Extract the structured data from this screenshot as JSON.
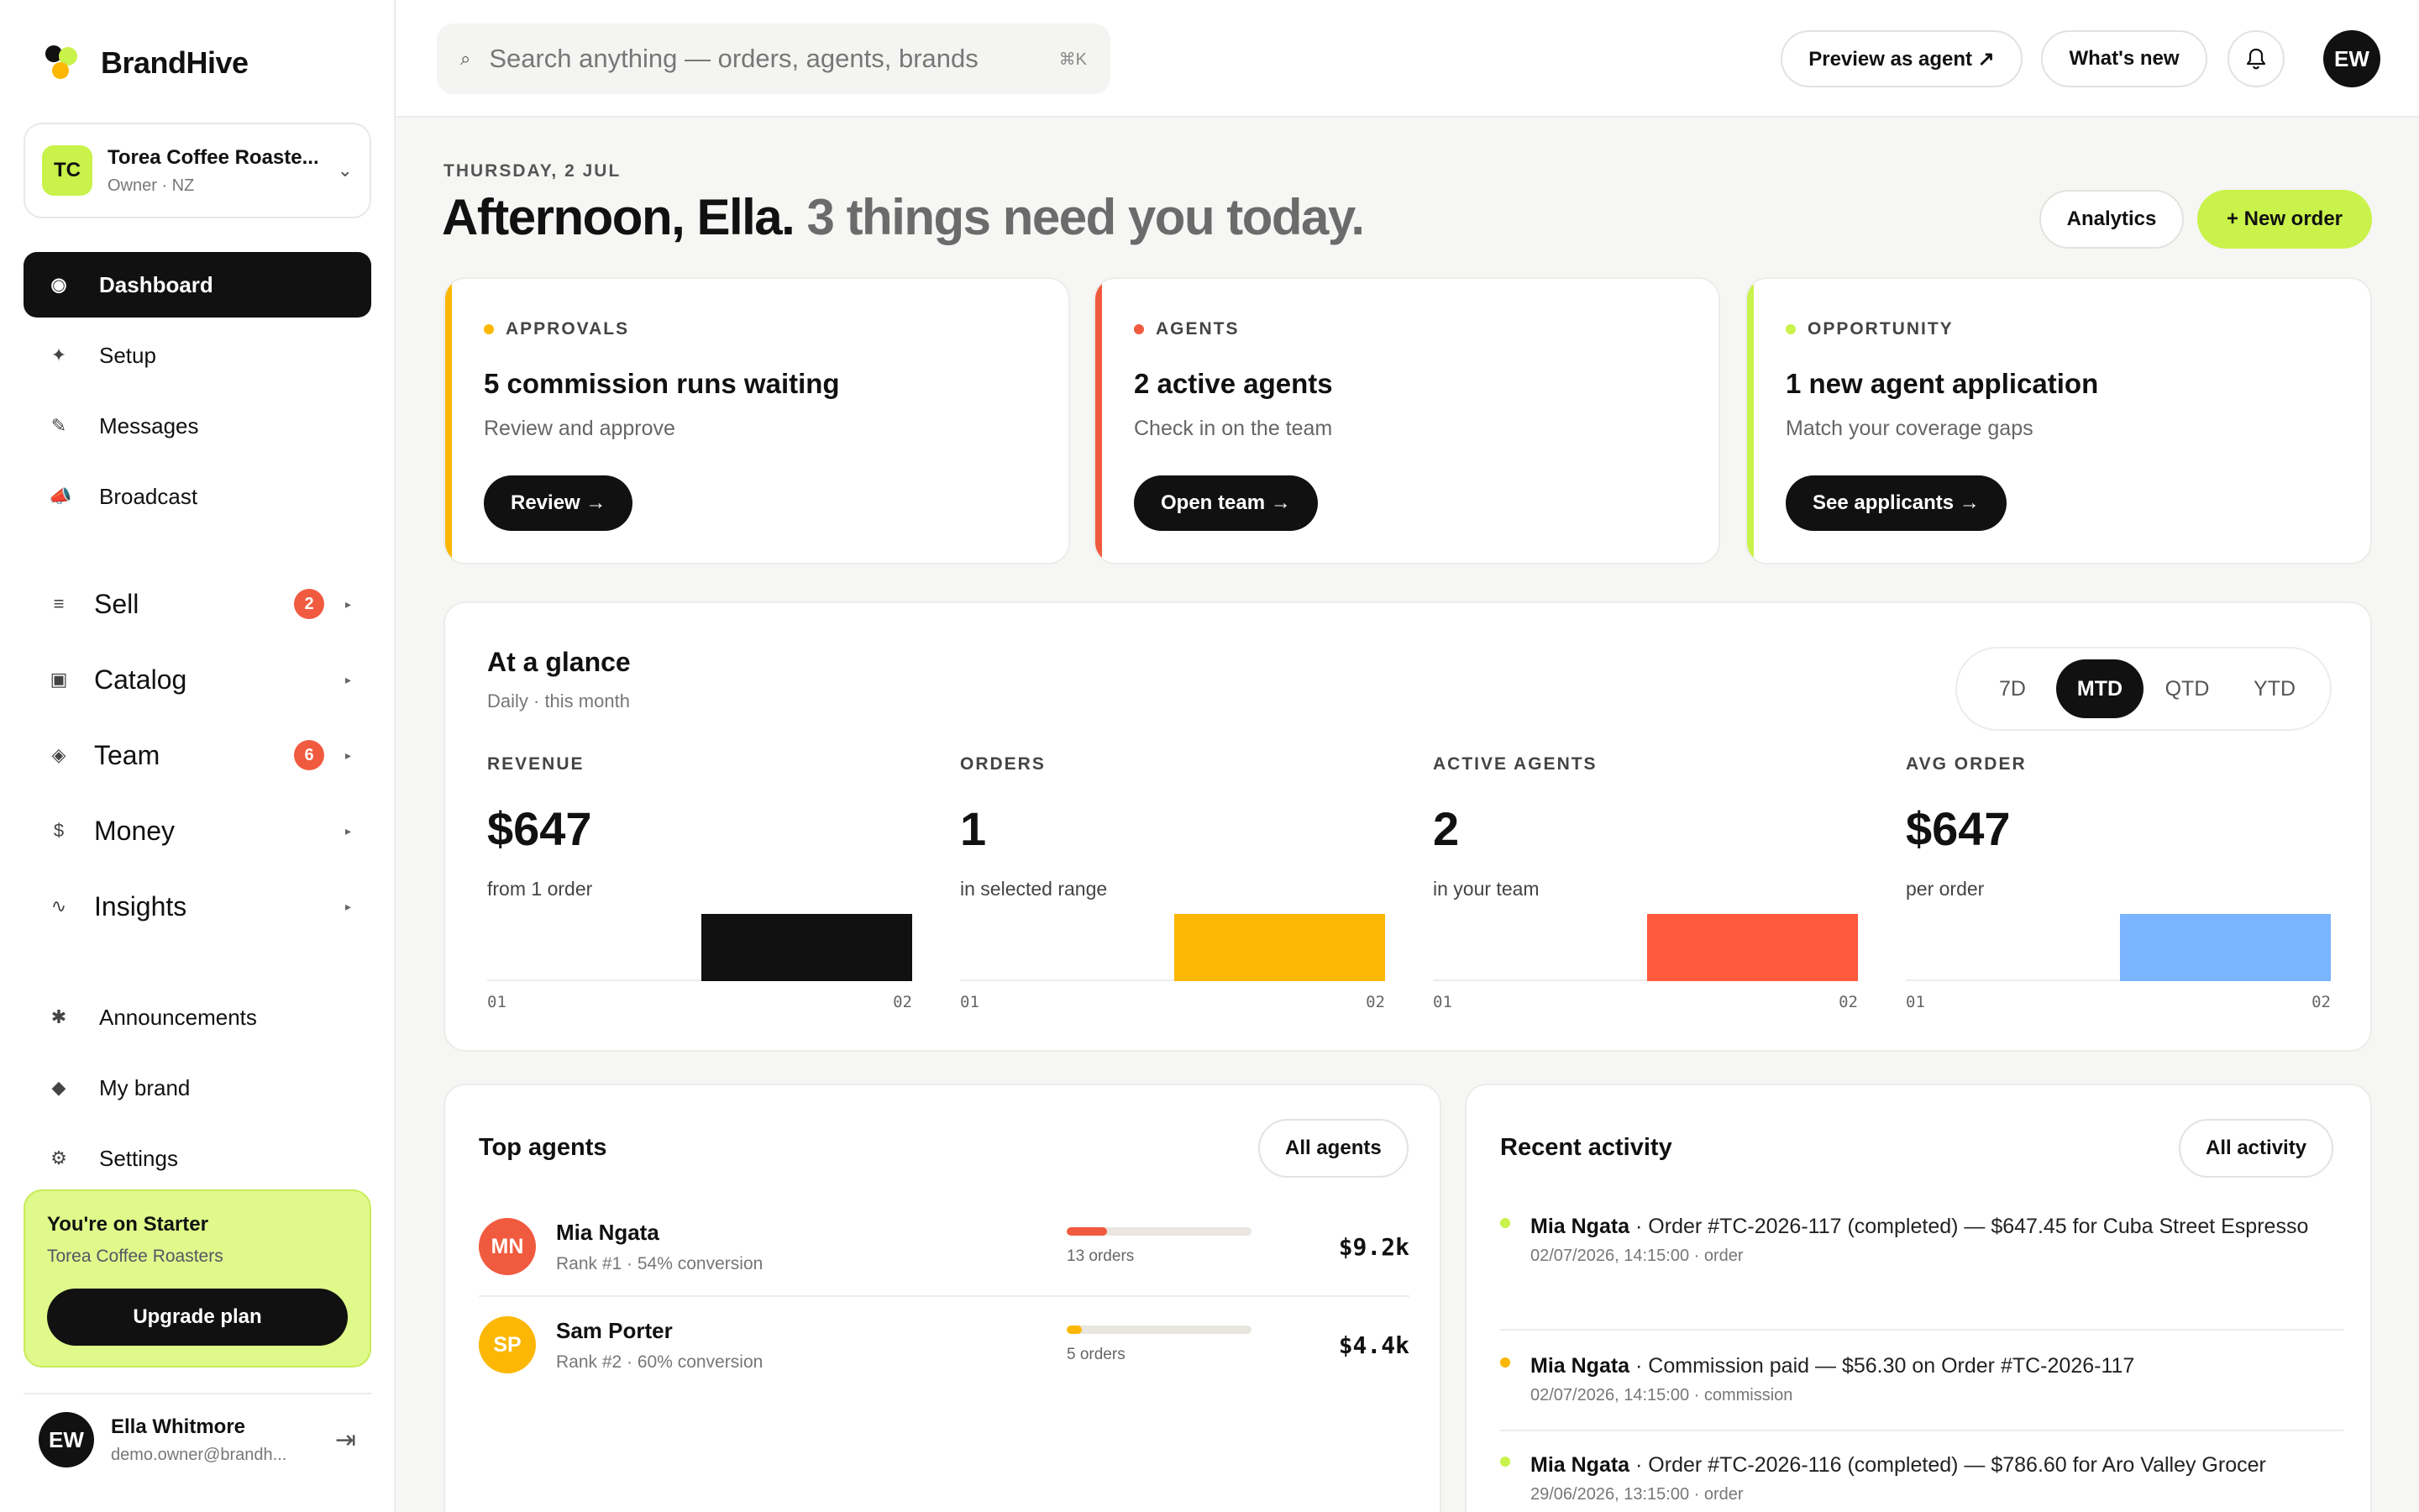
{
  "brand": {
    "name": "BrandHive"
  },
  "org": {
    "initials": "TC",
    "name": "Torea Coffee Roaste...",
    "role": "Owner · NZ"
  },
  "nav": {
    "primary": [
      {
        "label": "Dashboard",
        "icon": "dashboard-icon"
      },
      {
        "label": "Setup",
        "icon": "sparkle-icon"
      },
      {
        "label": "Messages",
        "icon": "pencil-icon"
      },
      {
        "label": "Broadcast",
        "icon": "megaphone-icon"
      }
    ],
    "groups": [
      {
        "label": "Sell",
        "badge": "2"
      },
      {
        "label": "Catalog",
        "badge": ""
      },
      {
        "label": "Team",
        "badge": "6"
      },
      {
        "label": "Money",
        "badge": ""
      },
      {
        "label": "Insights",
        "badge": ""
      }
    ],
    "secondary": [
      {
        "label": "Announcements"
      },
      {
        "label": "My brand"
      },
      {
        "label": "Settings"
      }
    ]
  },
  "plan": {
    "title": "You're on Starter",
    "org": "Torea Coffee Roasters",
    "button": "Upgrade plan"
  },
  "user": {
    "initials": "EW",
    "name": "Ella Whitmore",
    "email": "demo.owner@brandh..."
  },
  "topbar": {
    "search_placeholder": "Search anything — orders, agents, brands",
    "search_shortcut": "⌘K",
    "preview_label": "Preview as agent ↗",
    "whats_new_label": "What's new",
    "avatar": "EW"
  },
  "header": {
    "date": "THURSDAY, 2 JUL",
    "greeting": "Afternoon, Ella.",
    "summary": "3 things need you today.",
    "analytics_label": "Analytics",
    "new_order_label": "+ New order"
  },
  "action_cards": [
    {
      "kicker": "APPROVALS",
      "title": "5 commission runs waiting",
      "subtitle": "Review and approve",
      "cta": "Review →",
      "accent": "#fbb703"
    },
    {
      "kicker": "AGENTS",
      "title": "2 active agents",
      "subtitle": "Check in on the team",
      "cta": "Open team →",
      "accent": "#f05a3f"
    },
    {
      "kicker": "OPPORTUNITY",
      "title": "1 new agent application",
      "subtitle": "Match your coverage gaps",
      "cta": "See applicants →",
      "accent": "#c9f24a"
    }
  ],
  "glance": {
    "title": "At a glance",
    "subtitle": "Daily · this month",
    "ranges": [
      "7D",
      "MTD",
      "QTD",
      "YTD"
    ],
    "selected_range": "MTD",
    "metrics": [
      {
        "label": "REVENUE",
        "value": "$647",
        "sub": "from 1 order",
        "color": "#111111",
        "x": [
          "01",
          "02"
        ],
        "series": [
          0,
          647
        ]
      },
      {
        "label": "ORDERS",
        "value": "1",
        "sub": "in selected range",
        "color": "#fbb703",
        "x": [
          "01",
          "02"
        ],
        "series": [
          0,
          1
        ]
      },
      {
        "label": "ACTIVE AGENTS",
        "value": "2",
        "sub": "in your team",
        "color": "#ff5a3c",
        "x": [
          "01",
          "02"
        ],
        "series": [
          0,
          2
        ]
      },
      {
        "label": "AVG ORDER",
        "value": "$647",
        "sub": "per order",
        "color": "#7bb4ff",
        "x": [
          "01",
          "02"
        ],
        "series": [
          0,
          647
        ]
      }
    ]
  },
  "top_agents": {
    "title": "Top agents",
    "button": "All agents",
    "rows": [
      {
        "initials": "MN",
        "name": "Mia Ngata",
        "sub": "Rank #1 · 54% conversion",
        "orders": "13 orders",
        "order_share": 0.22,
        "amount": "$9.2k",
        "color": "#f05a3f"
      },
      {
        "initials": "SP",
        "name": "Sam Porter",
        "sub": "Rank #2 · 60% conversion",
        "orders": "5 orders",
        "order_share": 0.08,
        "amount": "$4.4k",
        "color": "#fbb703"
      }
    ]
  },
  "activity": {
    "title": "Recent activity",
    "button": "All activity",
    "items": [
      {
        "who": "Mia Ngata",
        "text": " · Order #TC-2026-117 (completed) — $647.45 for Cuba Street Espresso",
        "meta": "02/07/2026, 14:15:00 · order",
        "color": "#c9f24a"
      },
      {
        "who": "Mia Ngata",
        "text": " · Commission paid — $56.30 on Order #TC-2026-117",
        "meta": "02/07/2026, 14:15:00 · commission",
        "color": "#fbb703"
      },
      {
        "who": "Mia Ngata",
        "text": " · Order #TC-2026-116 (completed) — $786.60 for Aro Valley Grocer",
        "meta": "29/06/2026, 13:15:00 · order",
        "color": "#c9f24a"
      }
    ]
  }
}
